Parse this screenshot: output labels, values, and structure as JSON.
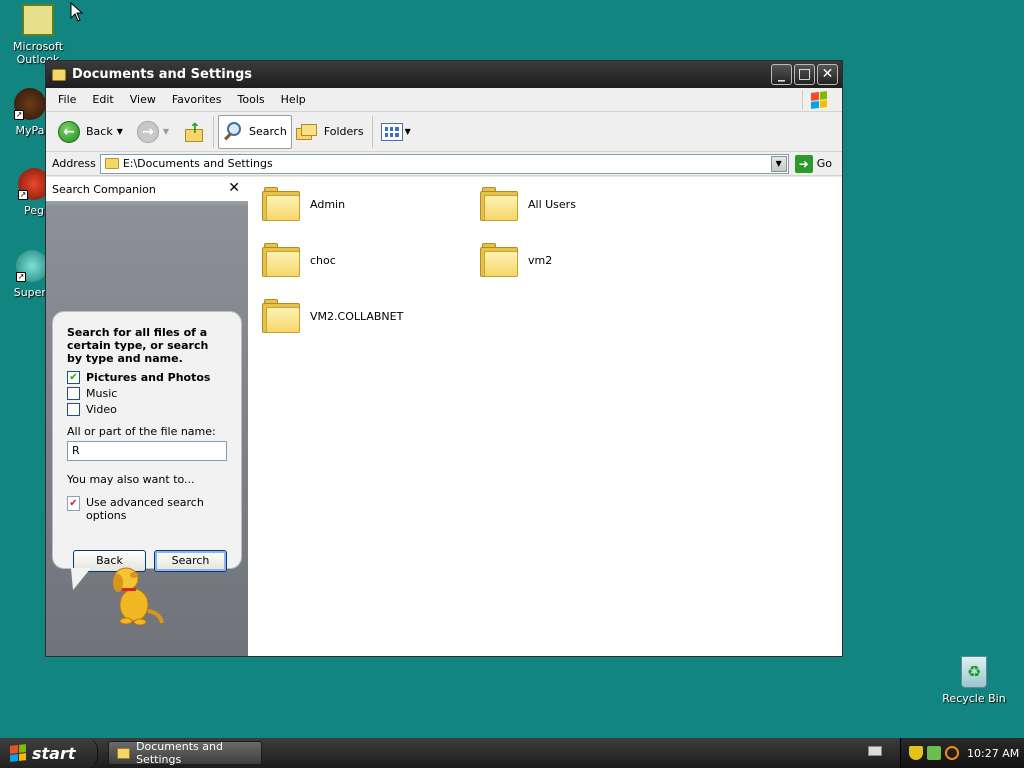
{
  "desktop": {
    "icons": [
      {
        "label": "Microsoft Outlook"
      },
      {
        "label": "MyPa"
      },
      {
        "label": "Peg"
      },
      {
        "label": "Superr"
      }
    ],
    "recycle_bin": "Recycle Bin"
  },
  "window": {
    "title": "Documents and Settings",
    "controls": {
      "minimize": "_",
      "maximize": "□",
      "close": "✕"
    }
  },
  "menu": [
    "File",
    "Edit",
    "View",
    "Favorites",
    "Tools",
    "Help"
  ],
  "toolbar": {
    "back": "Back",
    "search": "Search",
    "folders": "Folders"
  },
  "address": {
    "label": "Address",
    "value": "E:\\Documents and Settings",
    "go": "Go"
  },
  "search_companion": {
    "header": "Search Companion",
    "close": "✕",
    "prompt": "Search for all files of a certain type, or search by type and name.",
    "options": [
      {
        "label": "Pictures and Photos",
        "checked": true
      },
      {
        "label": "Music",
        "checked": false
      },
      {
        "label": "Video",
        "checked": false
      }
    ],
    "filename_label": "All or part of the file name:",
    "filename_value": "R",
    "also_label": "You may also want to...",
    "advanced_label": "Use advanced search options",
    "back_button": "Back",
    "search_button": "Search"
  },
  "files": [
    {
      "name": "Admin"
    },
    {
      "name": "All Users"
    },
    {
      "name": "choc"
    },
    {
      "name": "vm2"
    },
    {
      "name": "VM2.COLLABNET"
    }
  ],
  "taskbar": {
    "start": "start",
    "task": "Documents and Settings",
    "clock": "10:27 AM"
  },
  "colors": {
    "desktop": "#138580",
    "titlebar": "#2a2a2a",
    "folder": "#f5d66b"
  }
}
